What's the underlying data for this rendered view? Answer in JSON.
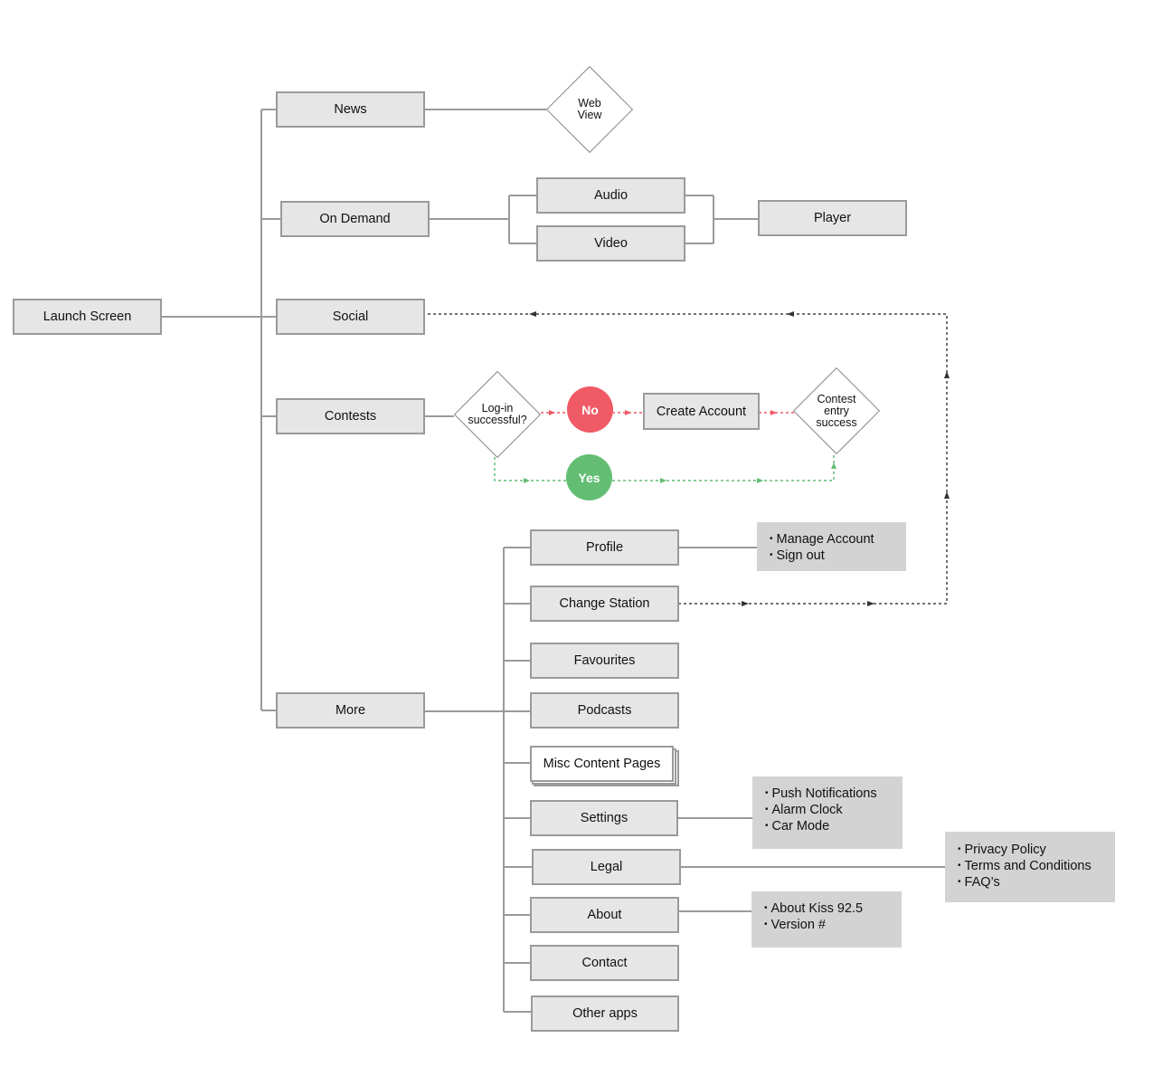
{
  "diagram": {
    "type": "sitemap-flowchart",
    "colors": {
      "node_fill": "#e6e6e6",
      "node_border": "#9a9a9a",
      "note_fill": "#d3d3d3",
      "connector": "#9a9a9a",
      "dashed_link": "#444444",
      "no_color": "#f05a66",
      "yes_color": "#63be74"
    },
    "root": {
      "label": "Launch Screen"
    },
    "main_sections": {
      "news": "News",
      "on_demand": "On Demand",
      "social": "Social",
      "contests": "Contests",
      "more": "More"
    },
    "news_flow": {
      "web_view": "Web\nView"
    },
    "on_demand_flow": {
      "audio": "Audio",
      "video": "Video",
      "player": "Player"
    },
    "contests_flow": {
      "login_decision": "Log-in\nsuccessful?",
      "no_label": "No",
      "yes_label": "Yes",
      "create_account": "Create Account",
      "entry_decision": "Contest\nentry\nsuccess"
    },
    "more_items": [
      {
        "label": "Profile"
      },
      {
        "label": "Change Station"
      },
      {
        "label": "Favourites"
      },
      {
        "label": "Podcasts"
      },
      {
        "label": "Misc Content Pages"
      },
      {
        "label": "Settings"
      },
      {
        "label": "Legal"
      },
      {
        "label": "About"
      },
      {
        "label": "Contact"
      },
      {
        "label": "Other apps"
      }
    ],
    "notes": {
      "profile": [
        "Manage Account",
        "Sign out"
      ],
      "settings": [
        "Push Notifications",
        "Alarm Clock",
        "Car Mode"
      ],
      "legal": [
        "Privacy Policy",
        "Terms and Conditions",
        "FAQ’s"
      ],
      "about": [
        "About Kiss 92.5",
        "Version #"
      ]
    },
    "edges": [
      {
        "from": "Launch Screen",
        "to": "News",
        "style": "solid"
      },
      {
        "from": "Launch Screen",
        "to": "On Demand",
        "style": "solid"
      },
      {
        "from": "Launch Screen",
        "to": "Social",
        "style": "solid"
      },
      {
        "from": "Launch Screen",
        "to": "Contests",
        "style": "solid"
      },
      {
        "from": "Launch Screen",
        "to": "More",
        "style": "solid"
      },
      {
        "from": "News",
        "to": "Web View",
        "style": "solid"
      },
      {
        "from": "On Demand",
        "to": "Audio",
        "style": "solid"
      },
      {
        "from": "On Demand",
        "to": "Video",
        "style": "solid"
      },
      {
        "from": "Audio",
        "to": "Player",
        "style": "solid"
      },
      {
        "from": "Video",
        "to": "Player",
        "style": "solid"
      },
      {
        "from": "Contests",
        "to": "Log-in successful?",
        "style": "solid"
      },
      {
        "from": "Log-in successful?",
        "to": "No",
        "style": "dashed-red"
      },
      {
        "from": "No",
        "to": "Create Account",
        "style": "dashed-red"
      },
      {
        "from": "Create Account",
        "to": "Contest entry success",
        "style": "dashed-red"
      },
      {
        "from": "Log-in successful?",
        "to": "Yes",
        "style": "dashed-green"
      },
      {
        "from": "Yes",
        "to": "Contest entry success",
        "style": "dashed-green"
      },
      {
        "from": "Change Station",
        "to": "Social",
        "style": "dashed"
      },
      {
        "from": "More",
        "to": "More items",
        "style": "solid"
      },
      {
        "from": "Profile",
        "to": "Profile note",
        "style": "solid"
      },
      {
        "from": "Settings",
        "to": "Settings note",
        "style": "solid"
      },
      {
        "from": "Legal",
        "to": "Legal note",
        "style": "solid"
      },
      {
        "from": "About",
        "to": "About note",
        "style": "solid"
      }
    ]
  }
}
